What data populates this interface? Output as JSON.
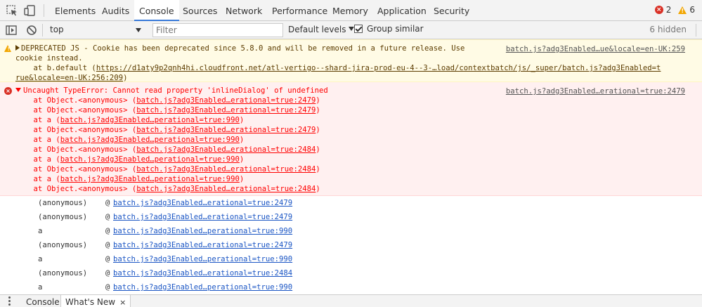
{
  "tabs": [
    "Elements",
    "Audits",
    "Console",
    "Sources",
    "Network",
    "Performance",
    "Memory",
    "Application",
    "Security"
  ],
  "active_tab": "Console",
  "counts": {
    "errors": "2",
    "warnings": "6"
  },
  "toolbar": {
    "context": "top",
    "filter_placeholder": "Filter",
    "levels": "Default levels",
    "group_similar": "Group similar",
    "hidden": "6 hidden"
  },
  "warning": {
    "line1": "DEPRECATED JS - Cookie has been deprecated since 5.8.0 and will be removed in a future release. Use",
    "line2": "cookie instead.",
    "line3_prefix": "    at b.default (",
    "line3_link": "https://d1aty9p2qnh4hi.cloudfront.net/atl-vertigo--shard-jira-prod-eu-4--3-…load/contextbatch/js/_super/batch.js?adg3Enabled=t",
    "line4_link": "rue&locale=en-UK:256:209",
    "line4_suffix": ")",
    "source": "batch.js?adg3Enabled…ue&locale=en-UK:259"
  },
  "error": {
    "message": "Uncaught TypeError: Cannot read property 'inlineDialog' of undefined",
    "source": "batch.js?adg3Enabled…erational=true:2479",
    "stack": [
      {
        "fn": "    at Object.<anonymous> (",
        "loc": "batch.js?adg3Enabled…erational=true:2479"
      },
      {
        "fn": "    at Object.<anonymous> (",
        "loc": "batch.js?adg3Enabled…erational=true:2479"
      },
      {
        "fn": "    at a (",
        "loc": "batch.js?adg3Enabled…perational=true:990"
      },
      {
        "fn": "    at Object.<anonymous> (",
        "loc": "batch.js?adg3Enabled…erational=true:2479"
      },
      {
        "fn": "    at a (",
        "loc": "batch.js?adg3Enabled…perational=true:990"
      },
      {
        "fn": "    at Object.<anonymous> (",
        "loc": "batch.js?adg3Enabled…erational=true:2484"
      },
      {
        "fn": "    at a (",
        "loc": "batch.js?adg3Enabled…perational=true:990"
      },
      {
        "fn": "    at Object.<anonymous> (",
        "loc": "batch.js?adg3Enabled…erational=true:2484"
      },
      {
        "fn": "    at a (",
        "loc": "batch.js?adg3Enabled…perational=true:990"
      },
      {
        "fn": "    at Object.<anonymous> (",
        "loc": "batch.js?adg3Enabled…erational=true:2484"
      }
    ]
  },
  "trace": [
    {
      "fn": "(anonymous)",
      "at": "@",
      "loc": "batch.js?adg3Enabled…erational=true:2479"
    },
    {
      "fn": "(anonymous)",
      "at": "@",
      "loc": "batch.js?adg3Enabled…erational=true:2479"
    },
    {
      "fn": "a",
      "at": "@",
      "loc": "batch.js?adg3Enabled…perational=true:990"
    },
    {
      "fn": "(anonymous)",
      "at": "@",
      "loc": "batch.js?adg3Enabled…erational=true:2479"
    },
    {
      "fn": "a",
      "at": "@",
      "loc": "batch.js?adg3Enabled…perational=true:990"
    },
    {
      "fn": "(anonymous)",
      "at": "@",
      "loc": "batch.js?adg3Enabled…erational=true:2484"
    },
    {
      "fn": "a",
      "at": "@",
      "loc": "batch.js?adg3Enabled…perational=true:990"
    }
  ],
  "drawer": {
    "tabs": [
      "Console",
      "What's New"
    ],
    "close": "×"
  },
  "colors": {
    "accent": "#3879d9",
    "error": "#ff0000",
    "error_bg": "#fff0f0",
    "warning_bg": "#fffbe5",
    "link": "#1a55c4"
  }
}
